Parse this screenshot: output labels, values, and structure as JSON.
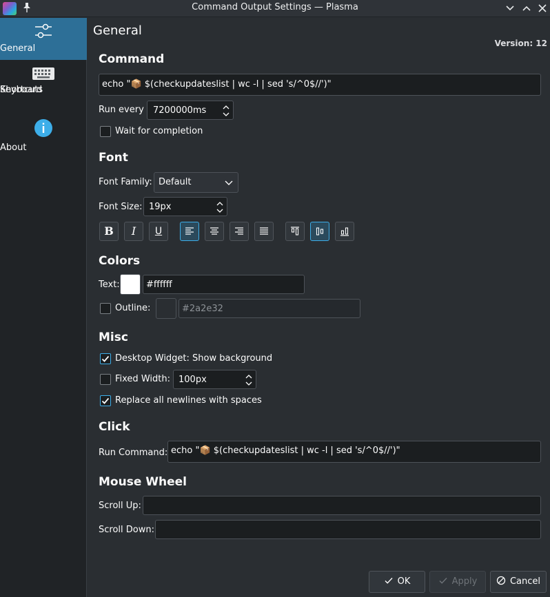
{
  "window": {
    "title": "Command Output Settings — Plasma",
    "pin_glyph": "📌",
    "minimize_glyph": "⌄",
    "maximize_glyph": "⌃",
    "close_glyph": "✕"
  },
  "sidebar": {
    "items": [
      {
        "label": "General",
        "icon": "sliders-icon",
        "active": true
      },
      {
        "label": "Keyboard",
        "label2": "Shortcuts",
        "icon": "keyboard-icon",
        "active": false
      },
      {
        "label": "About",
        "icon": "info-icon",
        "active": false
      }
    ]
  },
  "page": {
    "title": "General",
    "version": "Version: 12"
  },
  "command": {
    "heading": "Command",
    "value": "echo \"📦 $(checkupdateslist | wc -l | sed 's/^0$//')\"",
    "run_every_label": "Run every",
    "run_every_value": "7200000ms",
    "wait_label": "Wait for completion",
    "wait_checked": false
  },
  "font": {
    "heading": "Font",
    "family_label": "Font Family:",
    "family_value": "Default",
    "size_label": "Font Size:",
    "size_value": "19px",
    "bold": "B",
    "italic": "I",
    "underline": "U"
  },
  "colors": {
    "heading": "Colors",
    "text_label": "Text:",
    "text_value": "#ffffff",
    "text_swatch": "#ffffff",
    "outline_label": "Outline:",
    "outline_value": "#2a2e32",
    "outline_swatch": "#2a2e32",
    "outline_checked": false
  },
  "misc": {
    "heading": "Misc",
    "show_bg_label": "Desktop Widget: Show background",
    "show_bg_checked": true,
    "fixed_width_label": "Fixed Width:",
    "fixed_width_checked": false,
    "fixed_width_value": "100px",
    "replace_newlines_label": "Replace all newlines with spaces",
    "replace_newlines_checked": true
  },
  "click": {
    "heading": "Click",
    "run_command_label": "Run Command:",
    "run_command_value": "echo \"📦 $(checkupdateslist | wc -l | sed 's/^0$//')\""
  },
  "mouse_wheel": {
    "heading": "Mouse Wheel",
    "scroll_up_label": "Scroll Up:",
    "scroll_up_value": "",
    "scroll_down_label": "Scroll Down:",
    "scroll_down_value": ""
  },
  "buttons": {
    "ok": "OK",
    "apply": "Apply",
    "cancel": "Cancel"
  },
  "colors_theme": {
    "accent": "#3daee9",
    "selection": "#2d6f97",
    "background": "#2a2e32"
  }
}
